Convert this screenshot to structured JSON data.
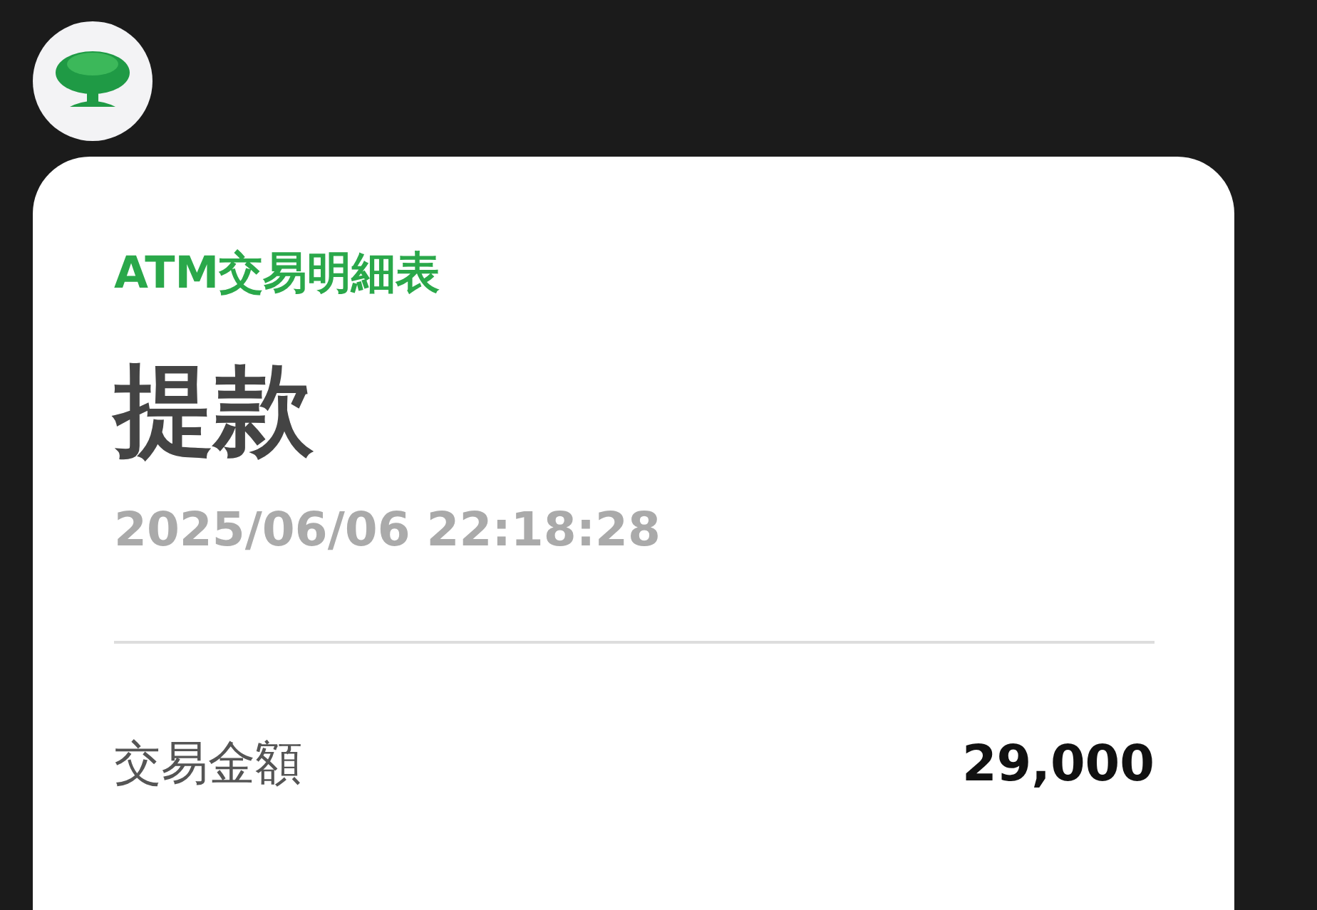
{
  "header": {
    "title": "ATM交易明細表"
  },
  "transaction": {
    "type": "提款",
    "datetime": "2025/06/06 22:18:28"
  },
  "details": [
    {
      "label": "交易金額",
      "value": "29,000"
    }
  ]
}
